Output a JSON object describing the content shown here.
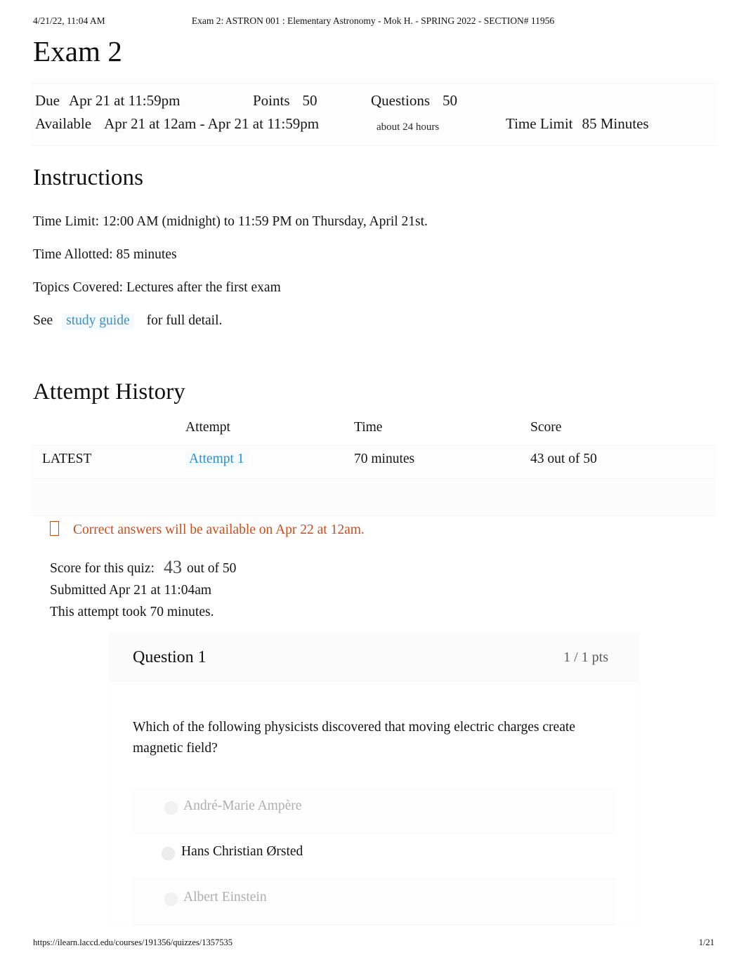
{
  "print_header": {
    "date": "4/21/22, 11:04 AM",
    "title": "Exam 2: ASTRON 001 : Elementary Astronomy - Mok H. - SPRING 2022 - SECTION# 11956"
  },
  "print_footer": {
    "url": "https://ilearn.laccd.edu/courses/191356/quizzes/1357535",
    "page": "1/21"
  },
  "quiz": {
    "title": "Exam 2",
    "due_label": "Due",
    "due_value": "Apr 21 at 11:59pm",
    "points_label": "Points",
    "points_value": "50",
    "questions_label": "Questions",
    "questions_value": "50",
    "available_label": "Available",
    "available_value": "Apr 21 at 12am - Apr 21 at 11:59pm",
    "available_duration": "about 24 hours",
    "time_limit_label": "Time Limit",
    "time_limit_value": "85 Minutes"
  },
  "instructions": {
    "heading": "Instructions",
    "time_limit": "Time Limit: 12:00 AM (midnight) to 11:59 PM on Thursday, April 21st.",
    "time_allotted": "Time Allotted: 85 minutes",
    "topics": "Topics Covered: Lectures after the first exam",
    "see_prefix": "See",
    "link_text": "study guide",
    "see_suffix": "for full detail."
  },
  "attempt_history": {
    "heading": "Attempt History",
    "columns": [
      "",
      "Attempt",
      "Time",
      "Score"
    ],
    "rows": [
      {
        "marker": "LATEST",
        "attempt": "Attempt 1",
        "time": "70 minutes",
        "score": "43 out of 50"
      }
    ]
  },
  "notice": {
    "icon": "info-circle-icon",
    "text": "Correct answers will be available on Apr 22 at 12am.",
    "color": "#cf4a17"
  },
  "score_summary": {
    "score_label": "Score for this quiz:",
    "score_value": "43",
    "score_out_of": "out of 50",
    "submitted": "Submitted Apr 21 at 11:04am",
    "duration": "This attempt took 70 minutes."
  },
  "question": {
    "number": "Question 1",
    "points": "1 / 1 pts",
    "text": "Which of the following physicists discovered that moving electric charges create magnetic field?",
    "answers": [
      {
        "label": "André-Marie Ampère",
        "selected": false
      },
      {
        "label": "Hans Christian Ørsted",
        "selected": true
      },
      {
        "label": "Albert Einstein",
        "selected": false
      }
    ]
  }
}
